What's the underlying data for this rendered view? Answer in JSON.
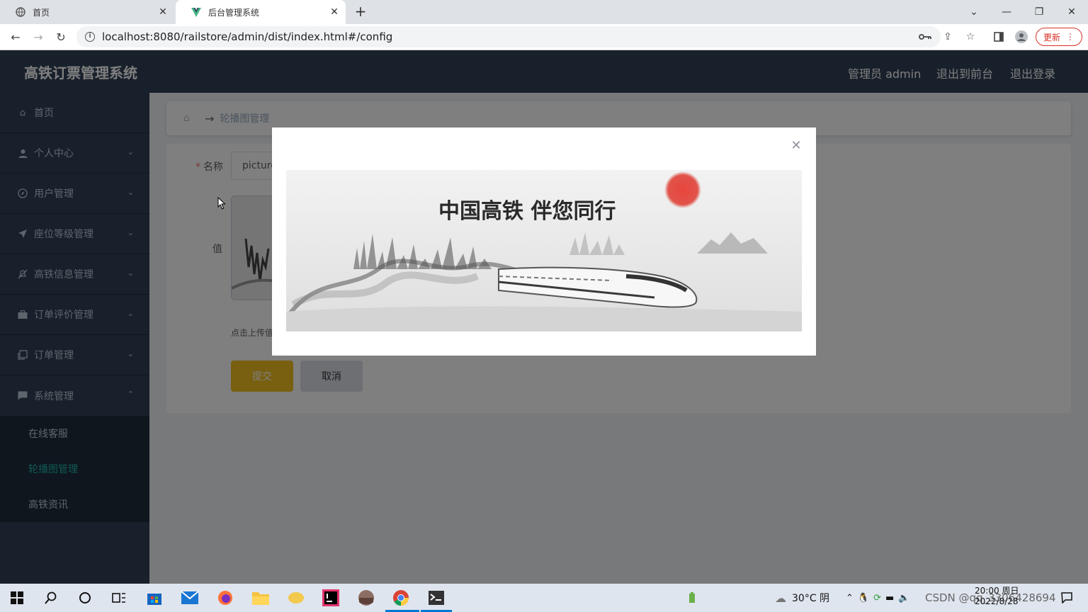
{
  "browser": {
    "tabs": [
      {
        "title": "首页"
      },
      {
        "title": "后台管理系统"
      }
    ],
    "url": "localhost:8080/railstore/admin/dist/index.html#/config",
    "update_label": "更新"
  },
  "app": {
    "brand": "高铁订票管理系统",
    "topnav": {
      "admin_label": "管理员 admin",
      "to_front": "退出到前台",
      "logout": "退出登录"
    },
    "sidebar": {
      "items": [
        {
          "label": "首页",
          "icon": "home-icon"
        },
        {
          "label": "个人中心",
          "icon": "user-icon"
        },
        {
          "label": "用户管理",
          "icon": "compass-icon"
        },
        {
          "label": "座位等级管理",
          "icon": "send-icon"
        },
        {
          "label": "高铁信息管理",
          "icon": "bell-off-icon"
        },
        {
          "label": "订单评价管理",
          "icon": "briefcase-icon"
        },
        {
          "label": "订单管理",
          "icon": "copy-icon"
        },
        {
          "label": "系统管理",
          "icon": "chat-icon"
        }
      ],
      "subitems": [
        {
          "label": "在线客服"
        },
        {
          "label": "轮播图管理"
        },
        {
          "label": "高铁资讯"
        }
      ],
      "active_color": "#20b2aa"
    },
    "breadcrumb": {
      "current": "轮播图管理"
    },
    "form": {
      "name_label": "名称",
      "name_value": "picture",
      "value_label": "值",
      "tip": "点击上传值",
      "submit": "提交",
      "cancel": "取消"
    },
    "dialog": {
      "banner_caption": "中国高铁 伴您同行"
    }
  },
  "taskbar": {
    "weather": "30°C 阴",
    "time": "20:00 周日",
    "date": "2022/8/28",
    "watermark": "CSDN @qq_3306428694"
  },
  "colors": {
    "header_bg": "#304156",
    "submit_bg": "#f0c020",
    "accent": "#20b2aa"
  }
}
